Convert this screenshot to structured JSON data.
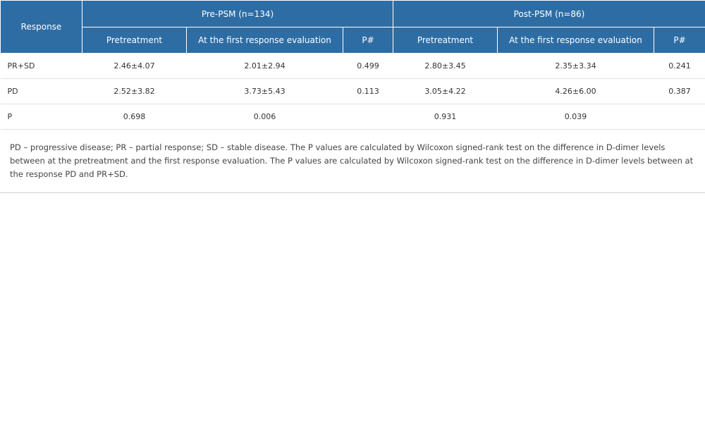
{
  "header": {
    "response_label": "Response",
    "groups": [
      {
        "label": "Pre-PSM (n=134)"
      },
      {
        "label": "Post-PSM (n=86)"
      }
    ],
    "subcolumns": [
      {
        "label": "Pretreatment"
      },
      {
        "label": "At the first response evaluation"
      },
      {
        "label": "P#"
      },
      {
        "label": "Pretreatment"
      },
      {
        "label": "At the first response evaluation"
      },
      {
        "label": "P#"
      }
    ]
  },
  "rows": [
    {
      "label": "PR+SD",
      "cells": [
        "2.46±4.07",
        "2.01±2.94",
        "0.499",
        "2.80±3.45",
        "2.35±3.34",
        "0.241"
      ]
    },
    {
      "label": "PD",
      "cells": [
        "2.52±3.82",
        "3.73±5.43",
        "0.113",
        "3.05±4.22",
        "4.26±6.00",
        "0.387"
      ]
    },
    {
      "label": "P",
      "cells": [
        "0.698",
        "0.006",
        "",
        "0.931",
        "0.039",
        ""
      ]
    }
  ],
  "footnote": "PD – progressive disease; PR – partial response; SD – stable disease. The P values are calculated by Wilcoxon signed-rank test on the difference in D-dimer levels between at the pretreatment and the first response evaluation. The P values are calculated by Wilcoxon signed-rank test on the difference in D-dimer levels between at the response PD and PR+SD."
}
